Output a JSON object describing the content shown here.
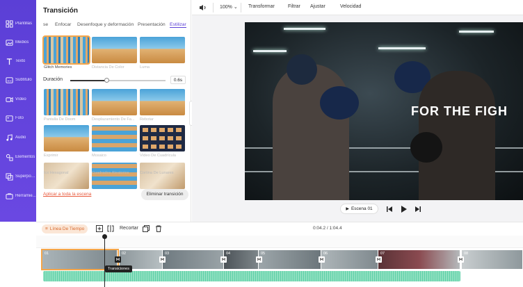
{
  "sidebar": {
    "items": [
      {
        "label": "Plantillas",
        "icon": "template-icon"
      },
      {
        "label": "Medios",
        "icon": "media-icon"
      },
      {
        "label": "Texto",
        "icon": "text-icon"
      },
      {
        "label": "Subtítulo",
        "icon": "subtitle-icon"
      },
      {
        "label": "Vídeo",
        "icon": "video-icon"
      },
      {
        "label": "Foto",
        "icon": "photo-icon"
      },
      {
        "label": "Audio",
        "icon": "audio-icon"
      },
      {
        "label": "Elementos",
        "icon": "elements-icon"
      },
      {
        "label": "Superposi...",
        "icon": "overlay-icon"
      },
      {
        "label": "Herramie...",
        "icon": "tools-icon"
      }
    ]
  },
  "panel": {
    "title": "Transición",
    "tabs": [
      "se",
      "Enfocar",
      "Desenfoque y deformación",
      "Presentación",
      "Estilizar"
    ],
    "active_tab": "Estilizar",
    "row1": [
      "Glitch Memories",
      "Distancia De Color",
      "Luma"
    ],
    "duration_label": "Duración",
    "duration_value": "0.6s",
    "duration_fraction": 0.38,
    "row2": [
      "Pantalla De Doom",
      "Desplazamiento De Fa...",
      "Rebotar"
    ],
    "row3": [
      "Exprimir",
      "Mosaico",
      "Vídeo De Cuadrícula"
    ],
    "row4": [
      "Icx Hexagonal",
      "Cuadrados Aleatorios",
      "Cortina De Lunares"
    ],
    "apply_all": "Aplicar a toda la escena",
    "remove": "Eliminar transición"
  },
  "toolbar": {
    "zoom": "100%",
    "transform": "Transformar",
    "filter": "Filtrar",
    "adjust": "Ajustar",
    "speed": "Velocidad"
  },
  "video": {
    "overlay_text": "FOR THE FIGH"
  },
  "player": {
    "scene": "Escena 01"
  },
  "timeline": {
    "mode": "Línea De Tiempo",
    "crop": "Recortar",
    "time": "0:04.2 / 1:04.4",
    "tooltip": "Transiciones",
    "clips": [
      "01",
      "02",
      "03",
      "04",
      "05",
      "06",
      "07",
      "08"
    ]
  },
  "colors": {
    "accent": "#5b3fd6",
    "selection": "#f5a64a",
    "link": "#e8583b"
  }
}
